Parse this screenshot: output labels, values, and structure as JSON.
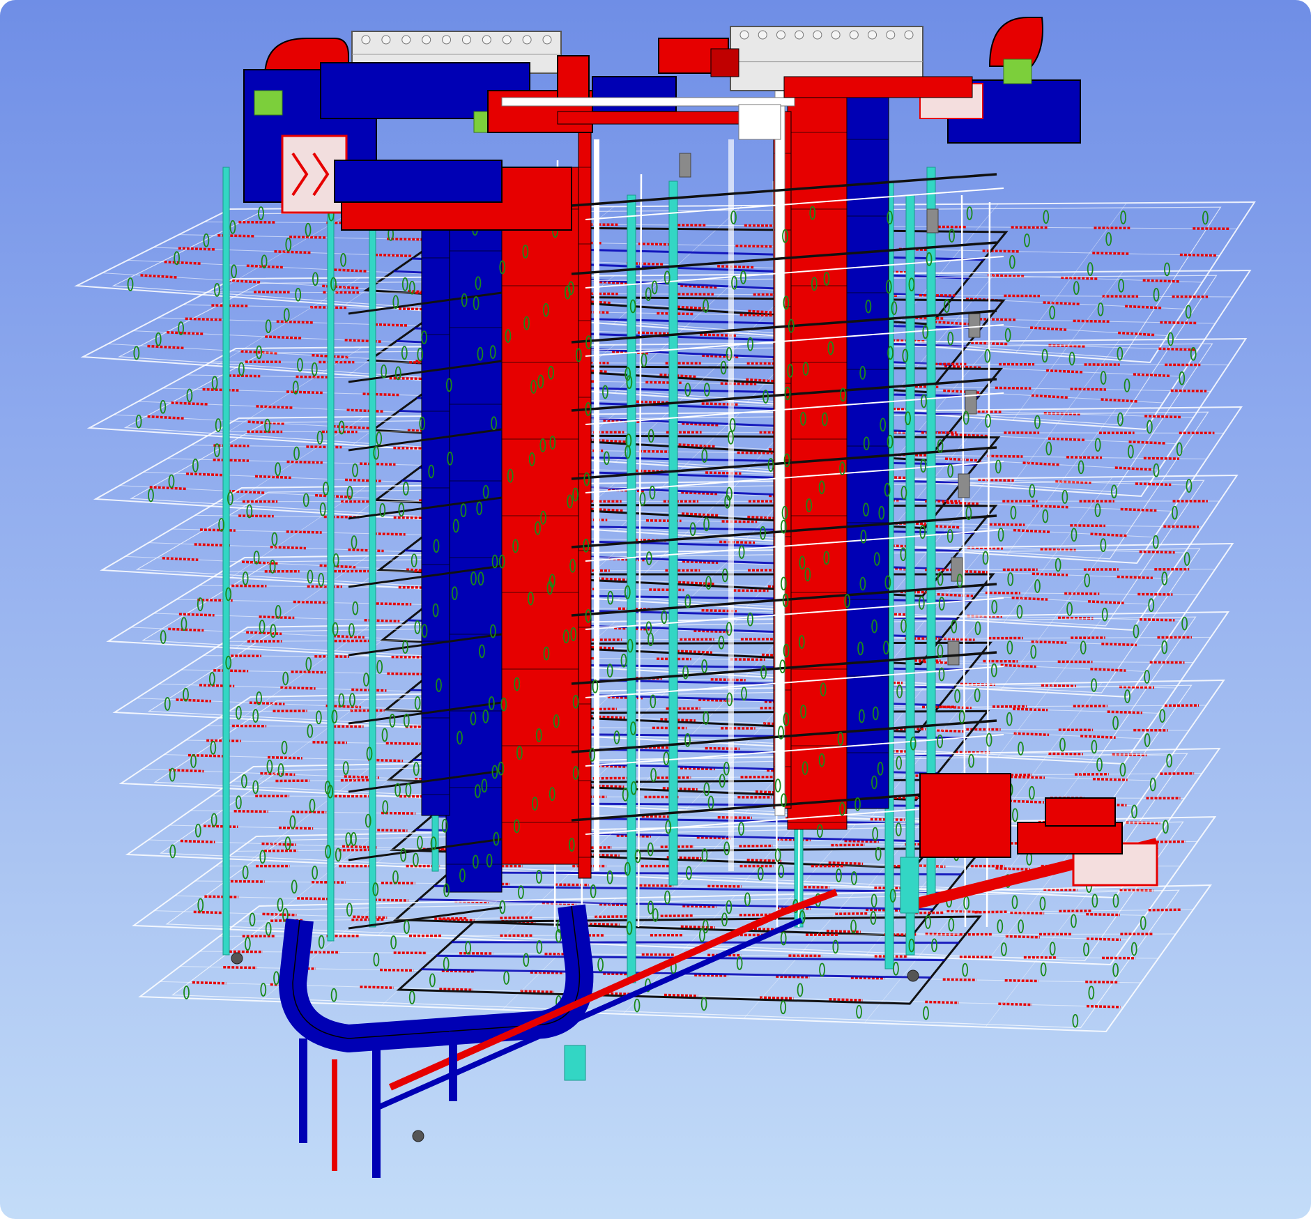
{
  "view": {
    "kind": "3D MEP coordination model view",
    "background_top": "#6f8ee6",
    "background_bottom": "#c3dcf8"
  },
  "colors": {
    "supply_duct": "#e60000",
    "return_duct": "#0000b4",
    "riser_pipe": "#33d6c4",
    "sprinkler_head": "#1a8a1a",
    "pipe_black": "#111111",
    "pipe_white": "#ffffff",
    "equipment_unit": "#e8e8e8",
    "access_green": "#7ccf3b",
    "valve_grey": "#8a8a8a"
  },
  "model": {
    "floors": 11,
    "rooftop_units": 2,
    "shafts": [
      "left-shaft",
      "right-shaft"
    ]
  }
}
